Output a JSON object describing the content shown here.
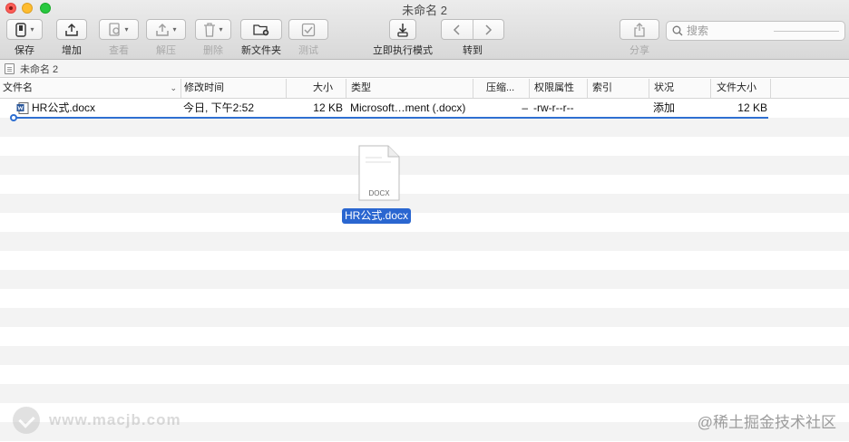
{
  "window": {
    "title": "未命名 2"
  },
  "toolbar": {
    "items": [
      {
        "label": "保存",
        "enabled": true
      },
      {
        "label": "增加",
        "enabled": true
      },
      {
        "label": "查看",
        "enabled": false
      },
      {
        "label": "解压",
        "enabled": false
      },
      {
        "label": "删除",
        "enabled": false
      },
      {
        "label": "新文件夹",
        "enabled": true
      },
      {
        "label": "测试",
        "enabled": false
      },
      {
        "label": "立即执行模式",
        "enabled": true
      },
      {
        "label": "转到",
        "enabled": true
      },
      {
        "label": "分享",
        "enabled": false
      }
    ],
    "search_placeholder": "搜索"
  },
  "pathbar": {
    "label": "未命名 2"
  },
  "table": {
    "headers": {
      "name": "文件名",
      "modified": "修改时间",
      "size": "大小",
      "kind": "类型",
      "compressed": "压缩...",
      "permissions": "权限属性",
      "index": "索引",
      "status": "状况",
      "file_size": "文件大小"
    },
    "rows": [
      {
        "name": "HR公式.docx",
        "modified": "今日, 下午2:52",
        "size": "12 KB",
        "kind": "Microsoft…ment (.docx)",
        "compressed": "–",
        "permissions": "-rw-r--r--",
        "index": "",
        "status": "添加",
        "file_size": "12 KB"
      }
    ]
  },
  "drag": {
    "icon_text": "DOCX",
    "label": "HR公式.docx"
  },
  "watermarks": {
    "left": "www.macjb.com",
    "right": "@稀土掘金技术社区"
  },
  "colors": {
    "accent": "#2a66d0",
    "stripe": "#f3f3f3"
  }
}
